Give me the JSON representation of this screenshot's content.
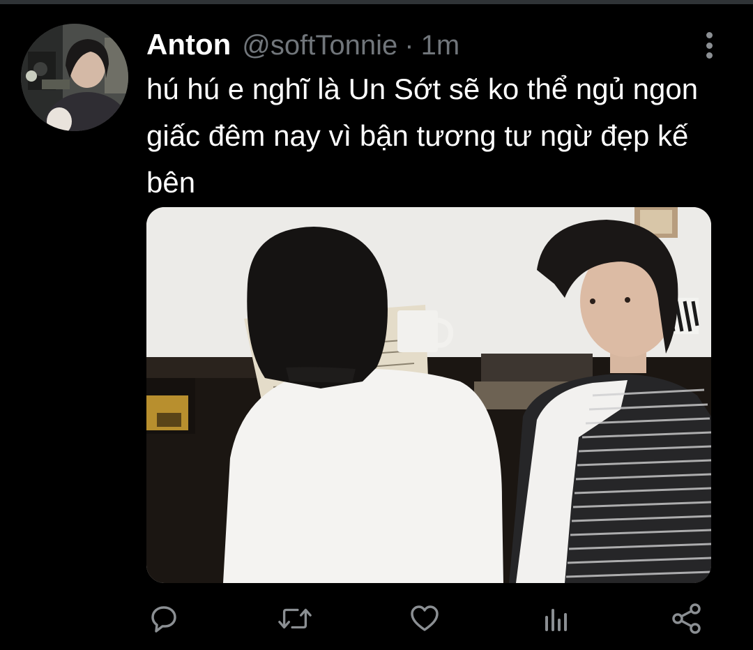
{
  "tweet": {
    "display_name": "Anton",
    "handle": "@softTonnie",
    "separator": "·",
    "time": "1m",
    "text": "hú hú e nghĩ là Un Sớt sẽ ko thể ngủ ngon giấc đêm nay vì bận tương tư ngừ đẹp kế bên"
  },
  "actions": {
    "reply_icon": "reply-icon",
    "retweet_icon": "retweet-icon",
    "like_icon": "heart-icon",
    "analytics_icon": "analytics-icon",
    "share_icon": "share-icon"
  },
  "colors": {
    "background": "#000000",
    "text_primary": "#ffffff",
    "text_secondary": "#71767b",
    "icon": "#8b8f93"
  }
}
